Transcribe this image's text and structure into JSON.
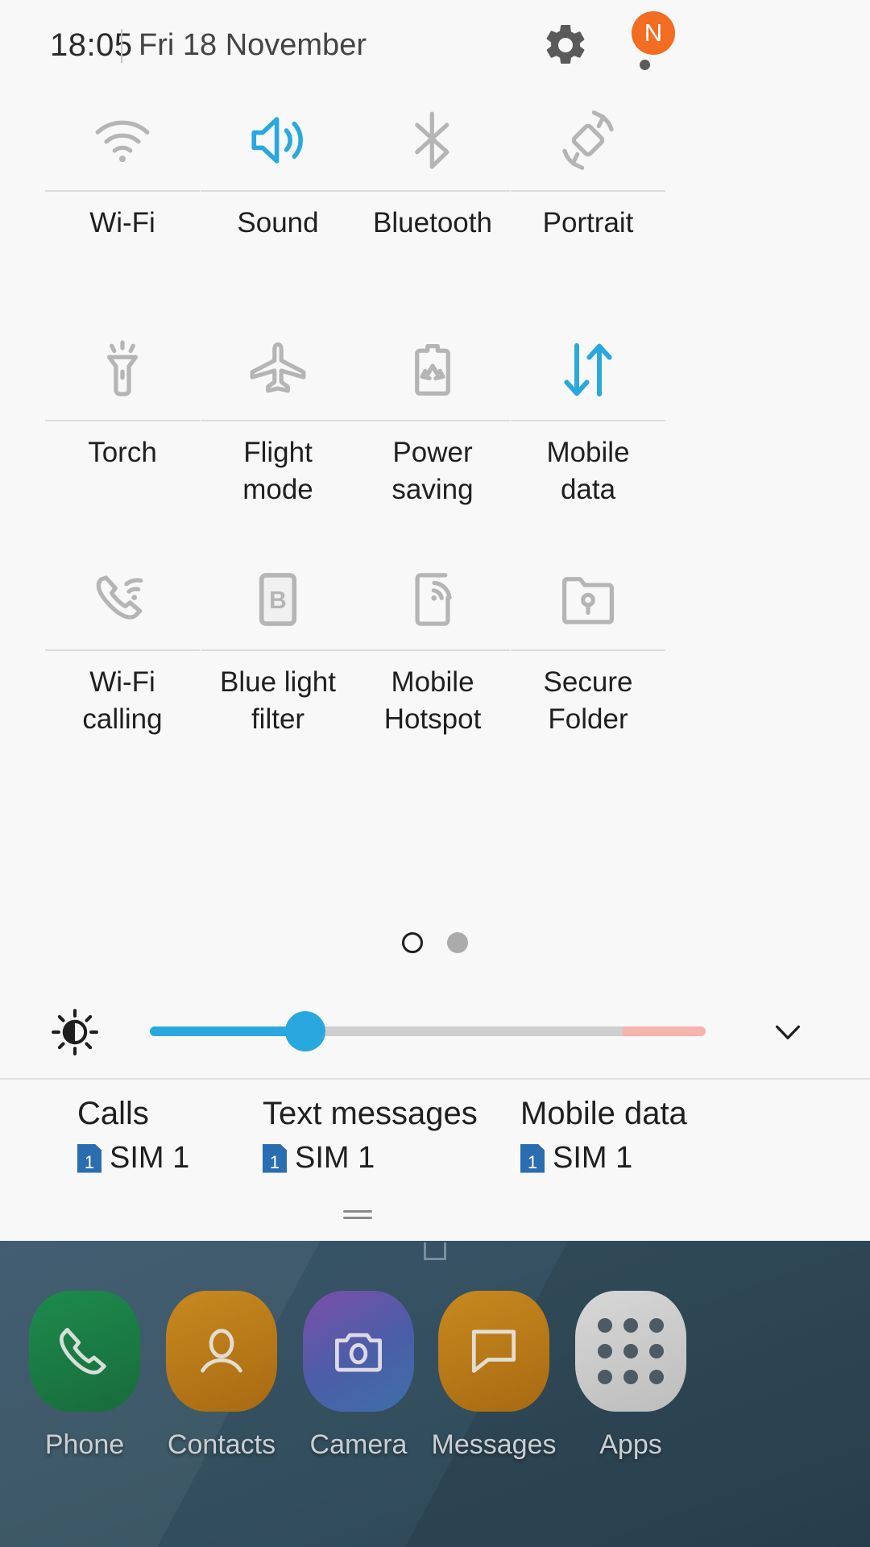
{
  "statusbar": {
    "time": "18:05",
    "date": "Fri 18 November",
    "separator": "|",
    "settings_icon": "gear-icon",
    "overflow_icon": "more-vertical-icon",
    "badge_label": "N",
    "badge_color": "#f26c21"
  },
  "quick_settings": {
    "active_color": "#29a8e0",
    "inactive_color": "#b5b5b5",
    "rows": [
      [
        {
          "label": "Wi-Fi",
          "icon": "wifi-icon",
          "active": false
        },
        {
          "label": "Sound",
          "icon": "sound-icon",
          "active": true
        },
        {
          "label": "Bluetooth",
          "icon": "bluetooth-icon",
          "active": false
        },
        {
          "label": "Portrait",
          "icon": "screen-rotation-icon",
          "active": false
        }
      ],
      [
        {
          "label": "Torch",
          "icon": "torch-icon",
          "active": false
        },
        {
          "label": "Flight\nmode",
          "icon": "airplane-icon",
          "active": false
        },
        {
          "label": "Power\nsaving",
          "icon": "power-saving-icon",
          "active": false
        },
        {
          "label": "Mobile\ndata",
          "icon": "mobile-data-icon",
          "active": true
        }
      ],
      [
        {
          "label": "Wi-Fi\ncalling",
          "icon": "wifi-calling-icon",
          "active": false
        },
        {
          "label": "Blue light\nfilter",
          "icon": "blue-light-filter-icon",
          "active": false
        },
        {
          "label": "Mobile\nHotspot",
          "icon": "mobile-hotspot-icon",
          "active": false
        },
        {
          "label": "Secure\nFolder",
          "icon": "secure-folder-icon",
          "active": false
        }
      ]
    ],
    "pager": {
      "pages": 2,
      "current": 1
    }
  },
  "brightness": {
    "icon": "brightness-icon",
    "value_percent": 28,
    "warn_zone_percent": 15,
    "expand_icon": "chevron-down-icon",
    "fill_color": "#29a8e0",
    "track_color": "#cfcfcf",
    "warn_color": "#f7b3ad"
  },
  "sim_settings": [
    {
      "title": "Calls",
      "sim_badge": "1",
      "sim_label": "SIM 1"
    },
    {
      "title": "Text messages",
      "sim_badge": "1",
      "sim_label": "SIM 1"
    },
    {
      "title": "Mobile data",
      "sim_badge": "1",
      "sim_label": "SIM 1"
    }
  ],
  "dock": [
    {
      "label": "Phone",
      "icon": "phone-icon",
      "color": "#1a7a44"
    },
    {
      "label": "Contacts",
      "icon": "contacts-icon",
      "color": "#c07f1a"
    },
    {
      "label": "Camera",
      "icon": "camera-icon",
      "color": "#5b4b9e"
    },
    {
      "label": "Messages",
      "icon": "messages-icon",
      "color": "#c07f1a"
    },
    {
      "label": "Apps",
      "icon": "apps-grid-icon",
      "color": "#c9c9c9"
    }
  ]
}
